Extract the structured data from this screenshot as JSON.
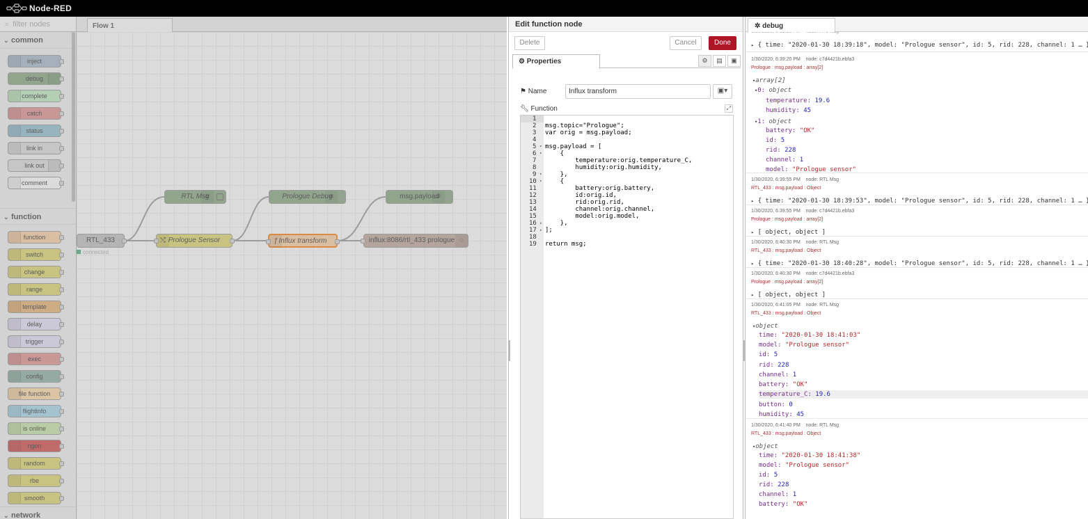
{
  "app": {
    "title": "Node-RED"
  },
  "palette": {
    "filter_placeholder": "filter nodes",
    "categories": [
      "common",
      "function",
      "network"
    ],
    "common": [
      {
        "label": "inject",
        "color": "#a6bbcf"
      },
      {
        "label": "debug",
        "color": "#87a980"
      },
      {
        "label": "complete",
        "color": "#c0edc0"
      },
      {
        "label": "catch",
        "color": "#e49191"
      },
      {
        "label": "status",
        "color": "#94c1d0"
      },
      {
        "label": "link in",
        "color": "#dddddd"
      },
      {
        "label": "link out",
        "color": "#dddddd"
      },
      {
        "label": "comment",
        "color": "#ffffff"
      }
    ],
    "function": [
      {
        "label": "function",
        "color": "#fdd0a2"
      },
      {
        "label": "switch",
        "color": "#e2d96e"
      },
      {
        "label": "change",
        "color": "#e2d96e"
      },
      {
        "label": "range",
        "color": "#e2d96e"
      },
      {
        "label": "template",
        "color": "#ebb473"
      },
      {
        "label": "delay",
        "color": "#e6e0f8"
      },
      {
        "label": "trigger",
        "color": "#e6e0f8"
      },
      {
        "label": "exec",
        "color": "#e49191"
      },
      {
        "label": "config",
        "color": "#8fb1a3"
      },
      {
        "label": "file function",
        "color": "#ffdba8"
      },
      {
        "label": "flightinfo",
        "color": "#a6d8ef"
      },
      {
        "label": "is online",
        "color": "#c7e9a8"
      },
      {
        "label": "ngon",
        "color": "#d44a4a"
      },
      {
        "label": "random",
        "color": "#e2d96e"
      },
      {
        "label": "rbe",
        "color": "#e2d96e"
      },
      {
        "label": "smooth",
        "color": "#e2d96e"
      }
    ]
  },
  "workspace": {
    "tab": "Flow 1",
    "nodes": {
      "rtl433": "RTL_433",
      "status": "connected",
      "rtl_msg": "RTL Msg",
      "prologue_sensor": "Prologue Sensor",
      "prologue_debug": "Prologue Debug",
      "influx_transform": "Influx transform",
      "msg_payload": "msg.payload",
      "influx_out": "influx:8086/rtl_433 prologue"
    }
  },
  "editor": {
    "title": "Edit function node",
    "delete": "Delete",
    "cancel": "Cancel",
    "done": "Done",
    "properties_tab": "Properties",
    "name_label": "Name",
    "name_value": "Influx transform",
    "function_label": "Function",
    "code_lines": [
      "",
      "msg.topic=\"Prologue\";",
      "var orig = msg.payload;",
      "",
      "msg.payload = [",
      "    {",
      "        temperature:orig.temperature_C,",
      "        humidity:orig.humidity,",
      "    },",
      "    {",
      "        battery:orig.battery,",
      "        id:orig.id,",
      "        rid:orig.rid,",
      "        channel:orig.channel,",
      "        model:orig.model,",
      "    },",
      "];",
      "",
      "return msg;"
    ],
    "line_numbers": [
      "1",
      "2",
      "3",
      "4",
      "5",
      "6",
      "7",
      "8",
      "9",
      "10",
      "11",
      "12",
      "13",
      "14",
      "15",
      "16",
      "17",
      "18",
      "19"
    ]
  },
  "debug": {
    "tab": "debug",
    "messages": [
      {
        "line": "{ time: \"2020-01-30 18:39:18\", model: \"Prologue sensor\", id: 5, rid: 228, channel: 1 … }"
      },
      {
        "meta": "1/30/2020, 6:39:20 PM    node: c7d4421b.ebfa3",
        "topic": "Prologue : msg.payload : array[2]"
      },
      {
        "meta": "1/30/2020, 6:39:55 PM    node: RTL Msg",
        "topic": "RTL_433 : msg.payload : Object",
        "line": "{ time: \"2020-01-30 18:39:53\", model: \"Prologue sensor\", id: 5, rid: 228, channel: 1 … }"
      },
      {
        "meta": "1/30/2020, 6:39:55 PM    node: c7d4421b.ebfa3",
        "topic": "Prologue : msg.payload : array[2]",
        "line": "[ object, object ]"
      },
      {
        "meta": "1/30/2020, 6:40:30 PM    node: RTL Msg",
        "topic": "RTL_433 : msg.payload : Object",
        "line": "{ time: \"2020-01-30 18:40:28\", model: \"Prologue sensor\", id: 5, rid: 228, channel: 1 … }"
      },
      {
        "meta": "1/30/2020, 6:40:30 PM    node: c7d4421b.ebfa3",
        "topic": "Prologue : msg.payload : array[2]",
        "line": "[ object, object ]"
      },
      {
        "meta": "1/30/2020, 6:41:05 PM    node: RTL Msg",
        "topic": "RTL_433 : msg.payload : Object"
      },
      {
        "meta": "1/30/2020, 6:41:40 PM    node: RTL Msg",
        "topic": "RTL_433 : msg.payload : Object"
      }
    ],
    "array_type": "array[2]",
    "obj0": "0: object",
    "obj1": "1: object",
    "object": "object",
    "temperature": "19.6",
    "humidity": "45",
    "battery": "\"OK\"",
    "id": "5",
    "rid": "228",
    "channel": "1",
    "model": "\"Prologue sensor\"",
    "button": "0",
    "time1": "\"2020-01-30 18:41:03\"",
    "time2": "\"2020-01-30 18:41:38\""
  }
}
